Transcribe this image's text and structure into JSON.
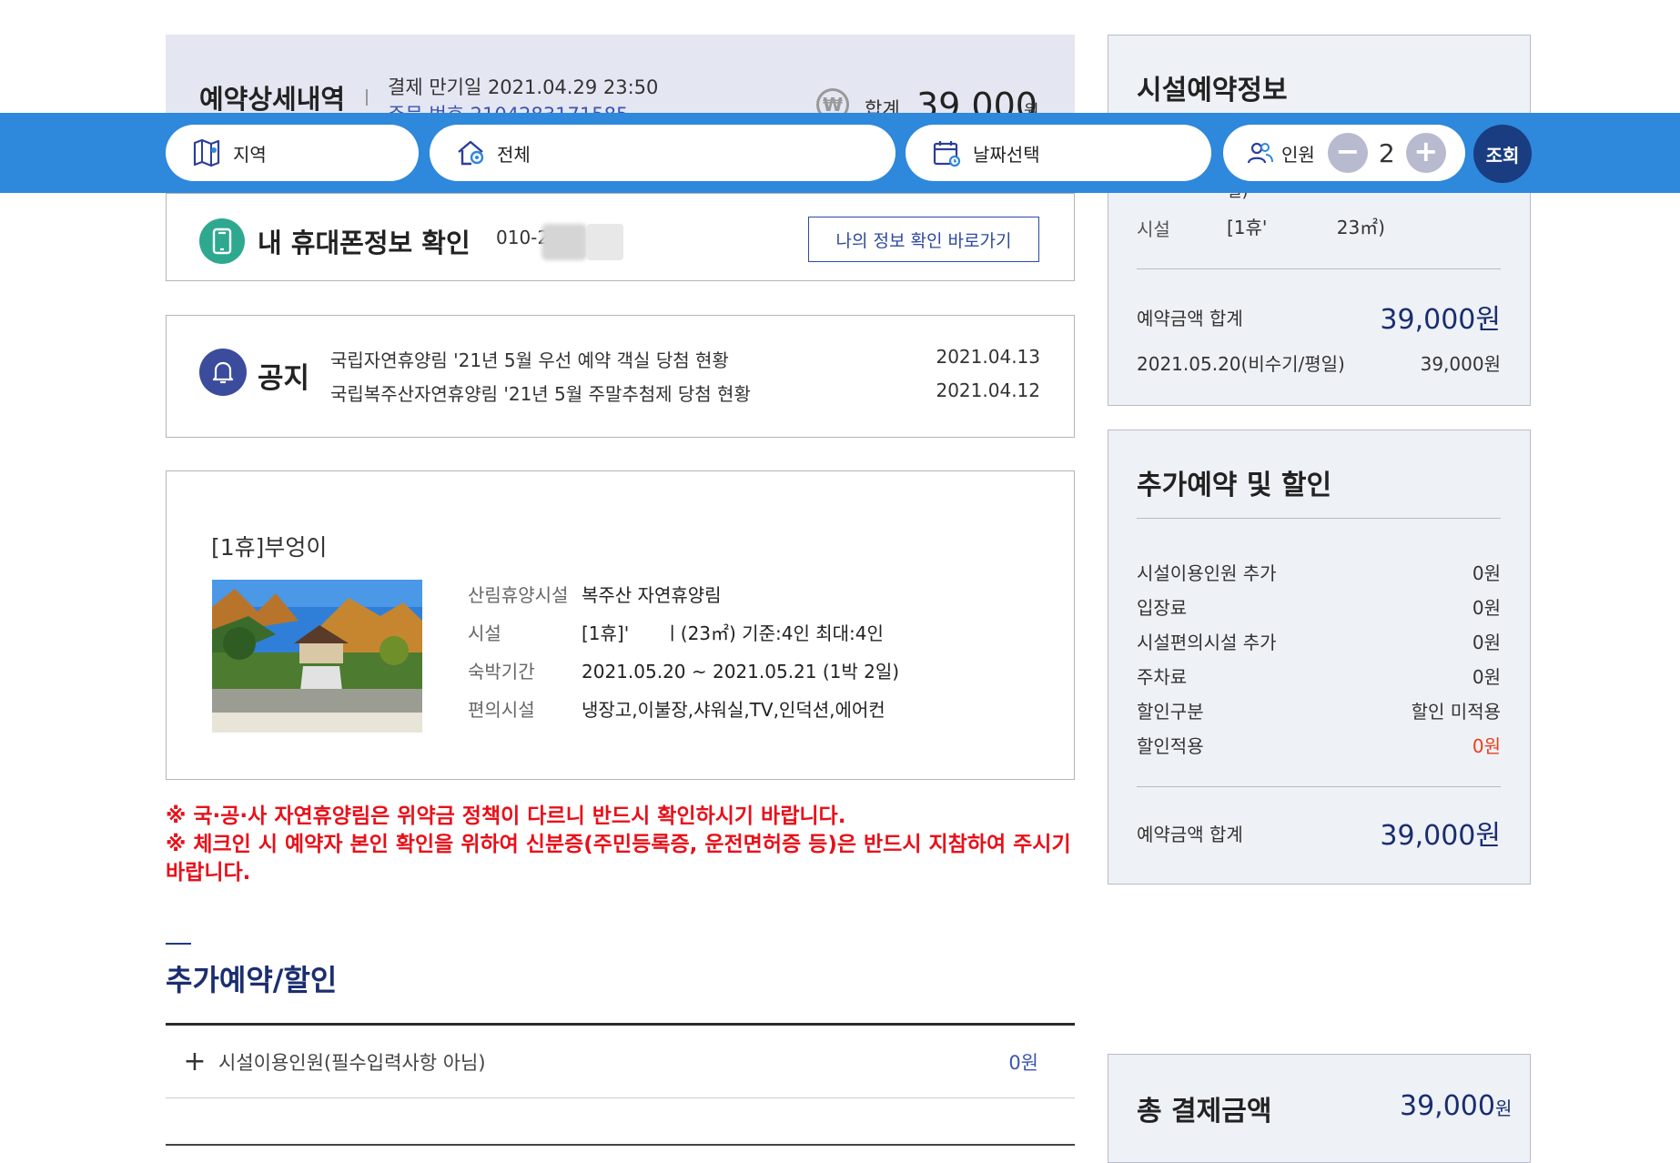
{
  "order": {
    "title": "예약상세내역",
    "deadline": "결제 만기일 2021.04.29 23:50",
    "order_number": "주문 번호 2104283171585",
    "total_label": "합계",
    "total_amount": "39,000",
    "total_unit": "원",
    "won_symbol": "₩"
  },
  "search": {
    "region_label": "지역",
    "all_label": "전체",
    "date_label": "날짜선택",
    "people_label": "인원",
    "people_count": "2",
    "minus": "−",
    "plus": "+",
    "search_label": "조회"
  },
  "phone": {
    "title": "내 휴대폰정보 확인",
    "number": "010-2",
    "myinfo_button": "나의 정보 확인 바로가기"
  },
  "notice": {
    "title": "공지",
    "items": [
      {
        "text": "국립자연휴양림 '21년 5월 우선 예약 객실 당첨 현황",
        "date": "2021.04.13"
      },
      {
        "text": "국립복주산자연휴양림 '21년 5월 주말추첨제 당첨 현황",
        "date": "2021.04.12"
      }
    ]
  },
  "facility": {
    "name": "[1휴]부엉이",
    "rows": [
      {
        "key": "산림휴양시설",
        "value": "복주산 자연휴양림"
      },
      {
        "key": "시설",
        "value": "[1휴]'      ㅣ(23㎡) 기준:4인 최대:4인"
      },
      {
        "key": "숙박기간",
        "value": "2021.05.20 ~ 2021.05.21 (1박 2일)"
      },
      {
        "key": "편의시설",
        "value": "냉장고,이불장,샤워실,TV,인덕션,에어컨"
      }
    ]
  },
  "warnings": [
    "※ 국·공·사 자연휴양림은 위약금 정책이 다르니 반드시 확인하시기 바랍니다.",
    "※ 체크인 시 예약자 본인 확인을 위하여 신분증(주민등록증, 운전면허증 등)은 반드시 지참하여 주시기 바랍니다."
  ],
  "addon_section": {
    "title": "추가예약/할인",
    "rows": [
      {
        "label": "시설이용인원(필수입력사항 아님)",
        "value": "0원"
      }
    ]
  },
  "side_info": {
    "title": "시설예약정보",
    "partial_line": "일)",
    "facility_key": "시설",
    "facility_value": "[1휴'            23㎡)",
    "sum_label": "예약금액 합계",
    "sum_value": "39,000원",
    "date_label": "2021.05.20(비수기/평일)",
    "date_value": "39,000원"
  },
  "side_addon": {
    "title": "추가예약 및 할인",
    "rows": [
      {
        "label": "시설이용인원 추가",
        "value": "0원"
      },
      {
        "label": "입장료",
        "value": "0원"
      },
      {
        "label": "시설편의시설 추가",
        "value": "0원"
      },
      {
        "label": "주차료",
        "value": "0원"
      },
      {
        "label": "할인구분",
        "value": "할인 미적용"
      },
      {
        "label": "할인적용",
        "value": "0원"
      }
    ],
    "sum_label": "예약금액 합계",
    "sum_value": "39,000원"
  },
  "side_total": {
    "title": "총 결제금액",
    "amount": "39,000",
    "unit": "원"
  },
  "colors": {
    "search_bar": "#2e88db",
    "search_button": "#1a3c80",
    "warning": "#e8101a",
    "accent_navy": "#1a2e70",
    "discount_red": "#e8401a"
  }
}
